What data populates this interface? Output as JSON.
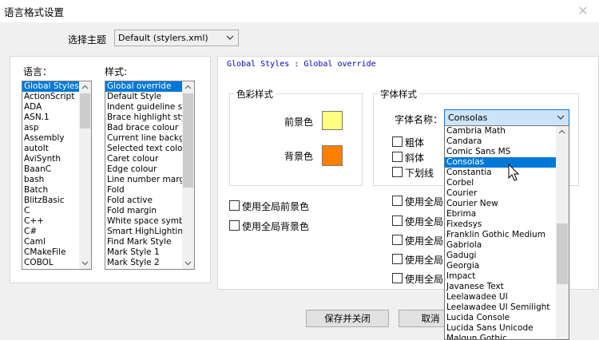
{
  "window": {
    "title": "语言格式设置",
    "close_glyph": "✕"
  },
  "theme": {
    "label": "选择主题",
    "selected": "Default (stylers.xml)"
  },
  "languages": {
    "label": "语言：",
    "items": [
      "Global Styles",
      "ActionScript",
      "ADA",
      "ASN.1",
      "asp",
      "Assembly",
      "autoIt",
      "AviSynth",
      "BaanC",
      "bash",
      "Batch",
      "BlitzBasic",
      "C",
      "C++",
      "C#",
      "Caml",
      "CMakeFile",
      "COBOL"
    ],
    "selected_index": 0
  },
  "styles": {
    "label": "样式:",
    "items": [
      "Global override",
      "Default Style",
      "Indent guideline style",
      "Brace highlight style",
      "Bad brace colour",
      "Current line background colour",
      "Selected text colour",
      "Caret colour",
      "Edge colour",
      "Line number margin",
      "Fold",
      "Fold active",
      "Fold margin",
      "White space symbol",
      "Smart HighLighting",
      "Find Mark Style",
      "Mark Style 1",
      "Mark Style 2"
    ],
    "selected_index": 0
  },
  "panel": {
    "header": "Global Styles : Global override"
  },
  "colour_group": {
    "title": "色彩样式",
    "fg_label": "前景色",
    "bg_label": "背景色",
    "fg_color": "#ffff80",
    "bg_color": "#ff8000"
  },
  "font_group": {
    "title": "字体样式",
    "name_label": "字体名称：",
    "selected_font": "Consolas",
    "bold": "粗体",
    "italic": "斜体",
    "underline": "下划线"
  },
  "global_checks": {
    "fg": "使用全局前景色",
    "bg": "使用全局背景色"
  },
  "global_checks_right": [
    "使用全局",
    "使用全局",
    "使用全局",
    "使用全局",
    "使用全局"
  ],
  "font_dropdown": {
    "items": [
      "Cambria Math",
      "Candara",
      "Comic Sans MS",
      "Consolas",
      "Constantia",
      "Corbel",
      "Courier",
      "Courier New",
      "Ebrima",
      "Fixedsys",
      "Franklin Gothic Medium",
      "Gabriola",
      "Gadugi",
      "Georgia",
      "Impact",
      "Javanese Text",
      "Leelawadee UI",
      "Leelawadee UI Semilight",
      "Lucida Console",
      "Lucida Sans Unicode",
      "Malgun Gothic"
    ],
    "selected_index": 3
  },
  "buttons": {
    "save_close": "保存并关闭",
    "cancel": "取消"
  }
}
